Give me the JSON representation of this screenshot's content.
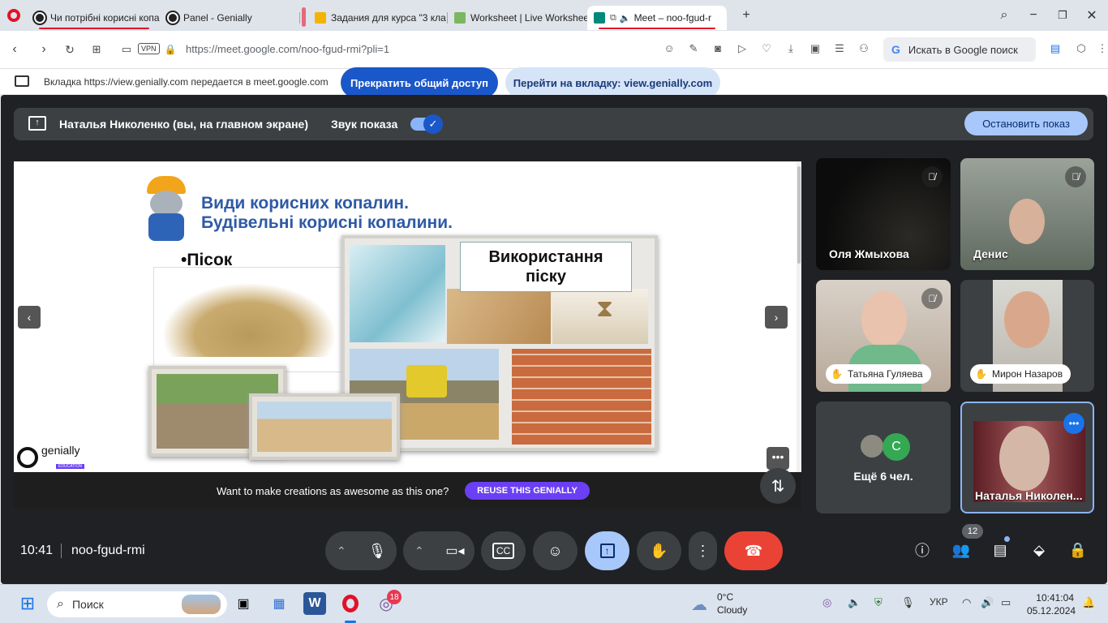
{
  "browser": {
    "tabs": [
      {
        "label": "Чи потрібні корисні копа"
      },
      {
        "label": "Panel - Genially"
      },
      {
        "label": "Задания для курса \"3 кла"
      },
      {
        "label": "Worksheet | Live Workshee"
      },
      {
        "label": "Meet – noo-fgud-r"
      }
    ],
    "url": "https://meet.google.com/noo-fgud-rmi?pli=1",
    "vpn_label": "VPN",
    "search_placeholder": "Искать в Google поиск"
  },
  "share_bar": {
    "message": "Вкладка https://view.genially.com передается в meet.google.com",
    "stop_sharing": "Прекратить общий доступ",
    "go_to_tab": "Перейти на вкладку: view.genially.com"
  },
  "presenting": {
    "presenter": "Наталья Николенко (вы, на главном экране)",
    "sound_label": "Звук показа",
    "sound_on": true,
    "stop_button": "Остановить показ"
  },
  "slide": {
    "title_line1": "Види корисних копалин.",
    "title_line2": "Будівельні корисні копалини.",
    "bullet": "•Пісок",
    "box_title": "Використання піску",
    "brand": "genially",
    "brand_sub": "EDUCATION",
    "footer_text": "Want to make creations as awesome as this one?",
    "reuse_button": "REUSE THIS GENIALLY"
  },
  "participants": [
    {
      "name": "Оля Жмыхова",
      "muted": true
    },
    {
      "name": "Денис",
      "muted": true
    },
    {
      "name": "Татьяна Гуляева",
      "muted": true,
      "hand": true
    },
    {
      "name": "Мирон Назаров",
      "hand": true
    },
    {
      "name": "Ещё 6 чел.",
      "avatar_letter": "C"
    },
    {
      "name": "Наталья Николен..."
    }
  ],
  "meeting": {
    "time": "10:41",
    "code": "noo-fgud-rmi",
    "people_count": "12"
  },
  "taskbar": {
    "search": "Поиск",
    "viber_badge": "18",
    "weather_temp": "0°C",
    "weather_desc": "Cloudy",
    "lang": "УКР",
    "time": "10:41:04",
    "date": "05.12.2024"
  },
  "colors": {
    "meet_bg": "#202124",
    "accent_blue": "#1a57c9",
    "end_call": "#ea4335",
    "opera_red": "#e1122a",
    "genially_purple": "#6a3ff5"
  }
}
